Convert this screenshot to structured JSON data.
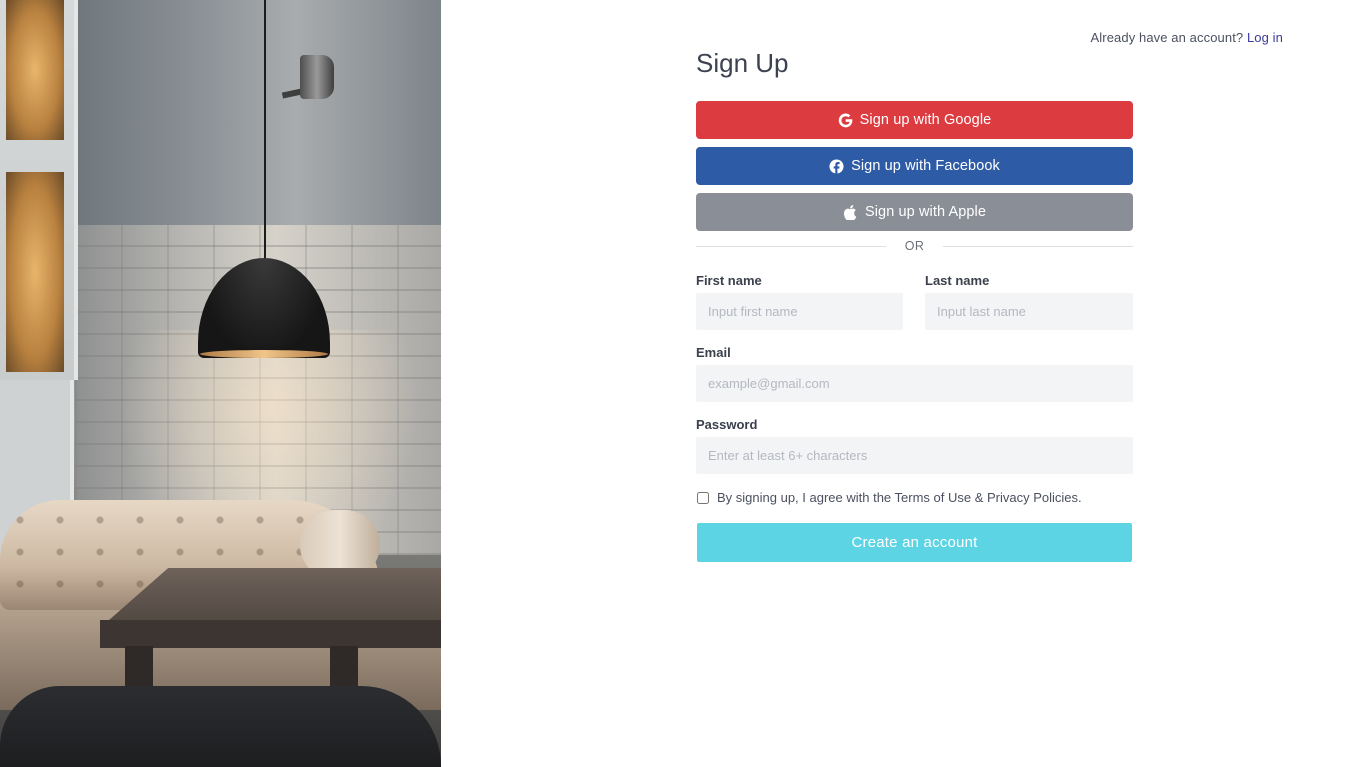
{
  "header": {
    "login_prompt": "Already have an account?",
    "login_link": "Log in"
  },
  "form": {
    "title": "Sign Up",
    "social": {
      "google": {
        "label": "Sign up with Google",
        "icon": "google-icon",
        "color": "#dc3b40"
      },
      "facebook": {
        "label": "Sign up with Facebook",
        "icon": "facebook-icon",
        "color": "#2e5ba6"
      },
      "apple": {
        "label": "Sign up with Apple",
        "icon": "apple-icon",
        "color": "#8a8e96"
      }
    },
    "divider_text": "OR",
    "first_name": {
      "label": "First name",
      "placeholder": "Input first name",
      "value": ""
    },
    "last_name": {
      "label": "Last name",
      "placeholder": "Input last name",
      "value": ""
    },
    "email": {
      "label": "Email",
      "placeholder": "example@gmail.com",
      "value": ""
    },
    "password": {
      "label": "Password",
      "placeholder": "Enter at least 6+ characters",
      "value": ""
    },
    "agree_text": "By signing up, I agree with the Terms of Use & Privacy Policies.",
    "agree_checked": false,
    "submit_label": "Create an account",
    "submit_color": "#5cd4e3"
  },
  "hero_image": {
    "icon": "interior-photo"
  }
}
